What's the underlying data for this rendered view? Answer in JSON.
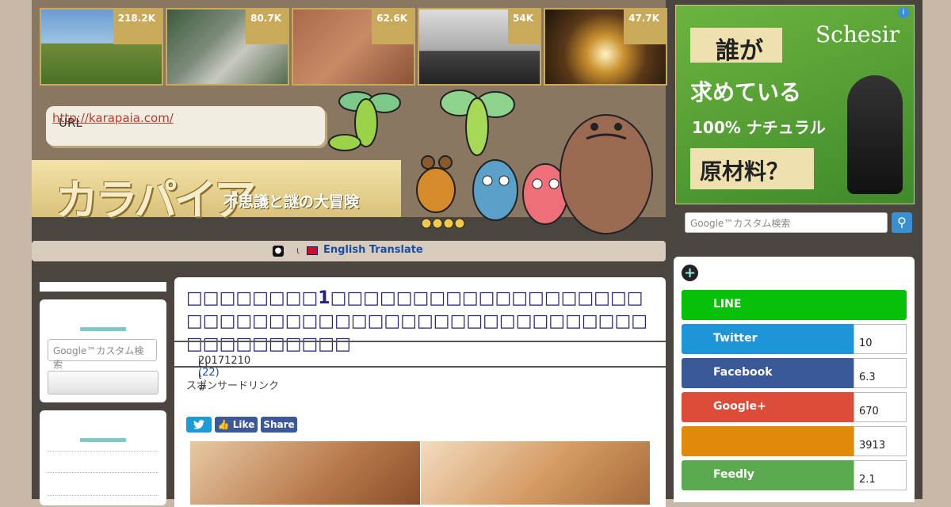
{
  "thumbnails": [
    {
      "count": "218.2K",
      "color": "linear-gradient(#6a9bd1 0%,#9ec3e3 45%,#6f8b3a 46%,#4a7125 100%)",
      "obj": "#b0202a"
    },
    {
      "count": "80.7K",
      "color": "linear-gradient(135deg,#3d5a3f,#7d8c7a 40%,#c8c8c0 60%,#556b4d)",
      "obj": "#d9d0a8"
    },
    {
      "count": "62.6K",
      "color": "linear-gradient(135deg,#a86a4a,#c98a66 50%,#8a5237)",
      "obj": "#6a8d3a"
    },
    {
      "count": "54K",
      "color": "linear-gradient(#dcdcdc 0%,#aaa 55%,#444 56%,#222 100%)",
      "obj": "#111"
    },
    {
      "count": "47.7K",
      "color": "radial-gradient(circle at 50% 60%,#fff4c0 0%,#c9902e 25%,#5a3818 55%,#1d140a 100%)",
      "obj": "#222"
    }
  ],
  "url_box": {
    "label": "URL",
    "link": "http://karapaia.com/"
  },
  "logo": {
    "title": "カラパイア",
    "tagline": "不思議と謎の大冒険"
  },
  "translate": {
    "icon": "globe-icon",
    "sep": "ι",
    "text": "English Translate"
  },
  "left_sidebar": {
    "search_placeholder": "Google™カスタム検索"
  },
  "article": {
    "title": "□□□□□□□□1□□□□□□□□□□□□□□□□□□□□□□□□□□□□□□□□□□□□□□□□□□□□□□□□□□□□□□□□□",
    "meta_date": "20171210",
    "meta_comments": "ι (22)",
    "meta_rest": "ι ι　 ι #",
    "sponsor": "スポンサードリンク",
    "share_buttons": [
      {
        "label": "",
        "color": "#1d9bd7",
        "icon": "twitter-icon"
      },
      {
        "label": "Like",
        "color": "#3b5998",
        "icon": "thumbs-up-icon"
      },
      {
        "label": "Share",
        "color": "#3b5998",
        "icon": ""
      }
    ]
  },
  "ad": {
    "brand": "Schesir",
    "lines": [
      "誰が",
      "求めている",
      "100% ナチュラル",
      "原材料？"
    ]
  },
  "right_search": {
    "placeholder": "Google™カスタム検索"
  },
  "share_list": [
    {
      "name": "LINE",
      "color": "#06c108",
      "count": ""
    },
    {
      "name": "Twitter",
      "color": "#1e94d9",
      "count": "10"
    },
    {
      "name": "Facebook",
      "color": "#3b5998",
      "count": "6.3"
    },
    {
      "name": "Google+",
      "color": "#dd4b39",
      "count": "670"
    },
    {
      "name": "",
      "color": "#e08a0a",
      "count": "3913"
    },
    {
      "name": "Feedly",
      "color": "#5ba94f",
      "count": "2.1"
    }
  ]
}
